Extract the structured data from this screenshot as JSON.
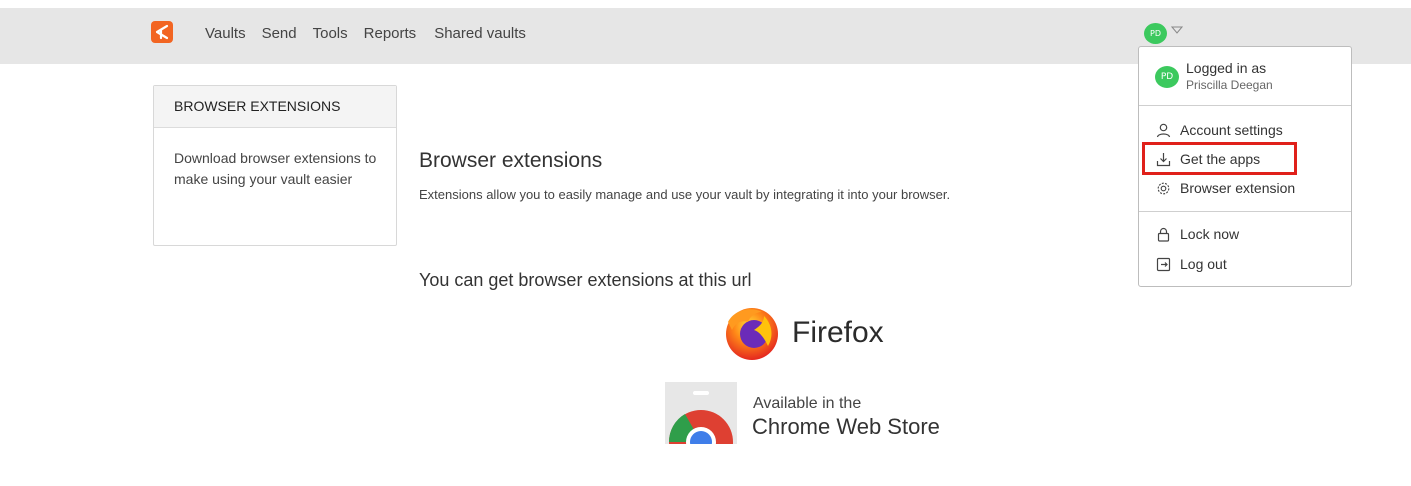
{
  "nav": {
    "items": [
      "Vaults",
      "Send",
      "Tools",
      "Reports",
      "Shared vaults"
    ]
  },
  "user": {
    "initials": "PD",
    "logged_in_label": "Logged in as",
    "name": "Priscilla Deegan"
  },
  "menu": {
    "account_settings": "Account settings",
    "get_apps": "Get the apps",
    "browser_extension": "Browser extension",
    "lock_now": "Lock now",
    "log_out": "Log out"
  },
  "sidebar": {
    "heading": "BROWSER EXTENSIONS",
    "description": "Download browser extensions to make using your vault easier"
  },
  "main": {
    "title": "Browser extensions",
    "description": "Extensions allow you to easily manage and use your vault by integrating it into your browser.",
    "url_text": "You can get browser extensions at this url"
  },
  "badges": {
    "firefox": "Firefox",
    "chrome_line1": "Available in the",
    "chrome_line2": "Chrome Web Store"
  },
  "colors": {
    "brand": "#f26522",
    "avatar": "#3cc95e",
    "highlight": "#e0201a",
    "topbar": "#e6e6e6"
  }
}
